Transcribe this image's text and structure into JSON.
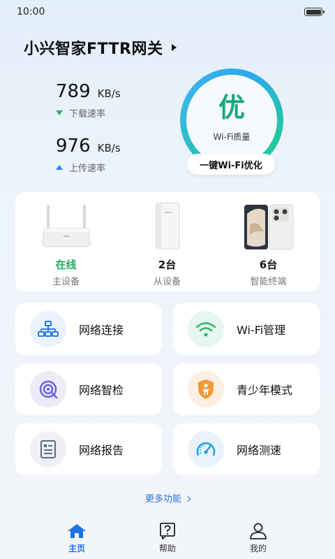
{
  "status_bar": {
    "time": "10:00"
  },
  "header": {
    "device_title": "小兴智家FTTR网关"
  },
  "speed": {
    "download": {
      "value": "789",
      "unit": "KB/s",
      "label": "下载速率"
    },
    "upload": {
      "value": "976",
      "unit": "KB/s",
      "label": "上传速率"
    }
  },
  "wifi_quality": {
    "grade": "优",
    "caption": "Wi-Fi质量",
    "optimize_label": "一键Wi-Fi优化"
  },
  "devices": [
    {
      "status": "在线",
      "name": "主设备"
    },
    {
      "status": "2台",
      "name": "从设备"
    },
    {
      "status": "6台",
      "name": "智能终端"
    }
  ],
  "features": [
    {
      "label": "网络连接",
      "icon": "network-topology-icon"
    },
    {
      "label": "Wi-Fi管理",
      "icon": "wifi-icon"
    },
    {
      "label": "网络智检",
      "icon": "network-check-icon"
    },
    {
      "label": "青少年模式",
      "icon": "teen-shield-icon"
    },
    {
      "label": "网络报告",
      "icon": "report-icon"
    },
    {
      "label": "网络测速",
      "icon": "speedometer-icon"
    }
  ],
  "more_functions": "更多功能",
  "tabs": [
    {
      "label": "主页",
      "icon": "home-icon",
      "active": true
    },
    {
      "label": "帮助",
      "icon": "help-icon",
      "active": false
    },
    {
      "label": "我的",
      "icon": "profile-icon",
      "active": false
    }
  ],
  "colors": {
    "accent": "#1d72e8",
    "online": "#25a85f",
    "quality": "#1da57e",
    "upload_arrow": "#2a86f0",
    "download_arrow": "#2bb36a"
  }
}
